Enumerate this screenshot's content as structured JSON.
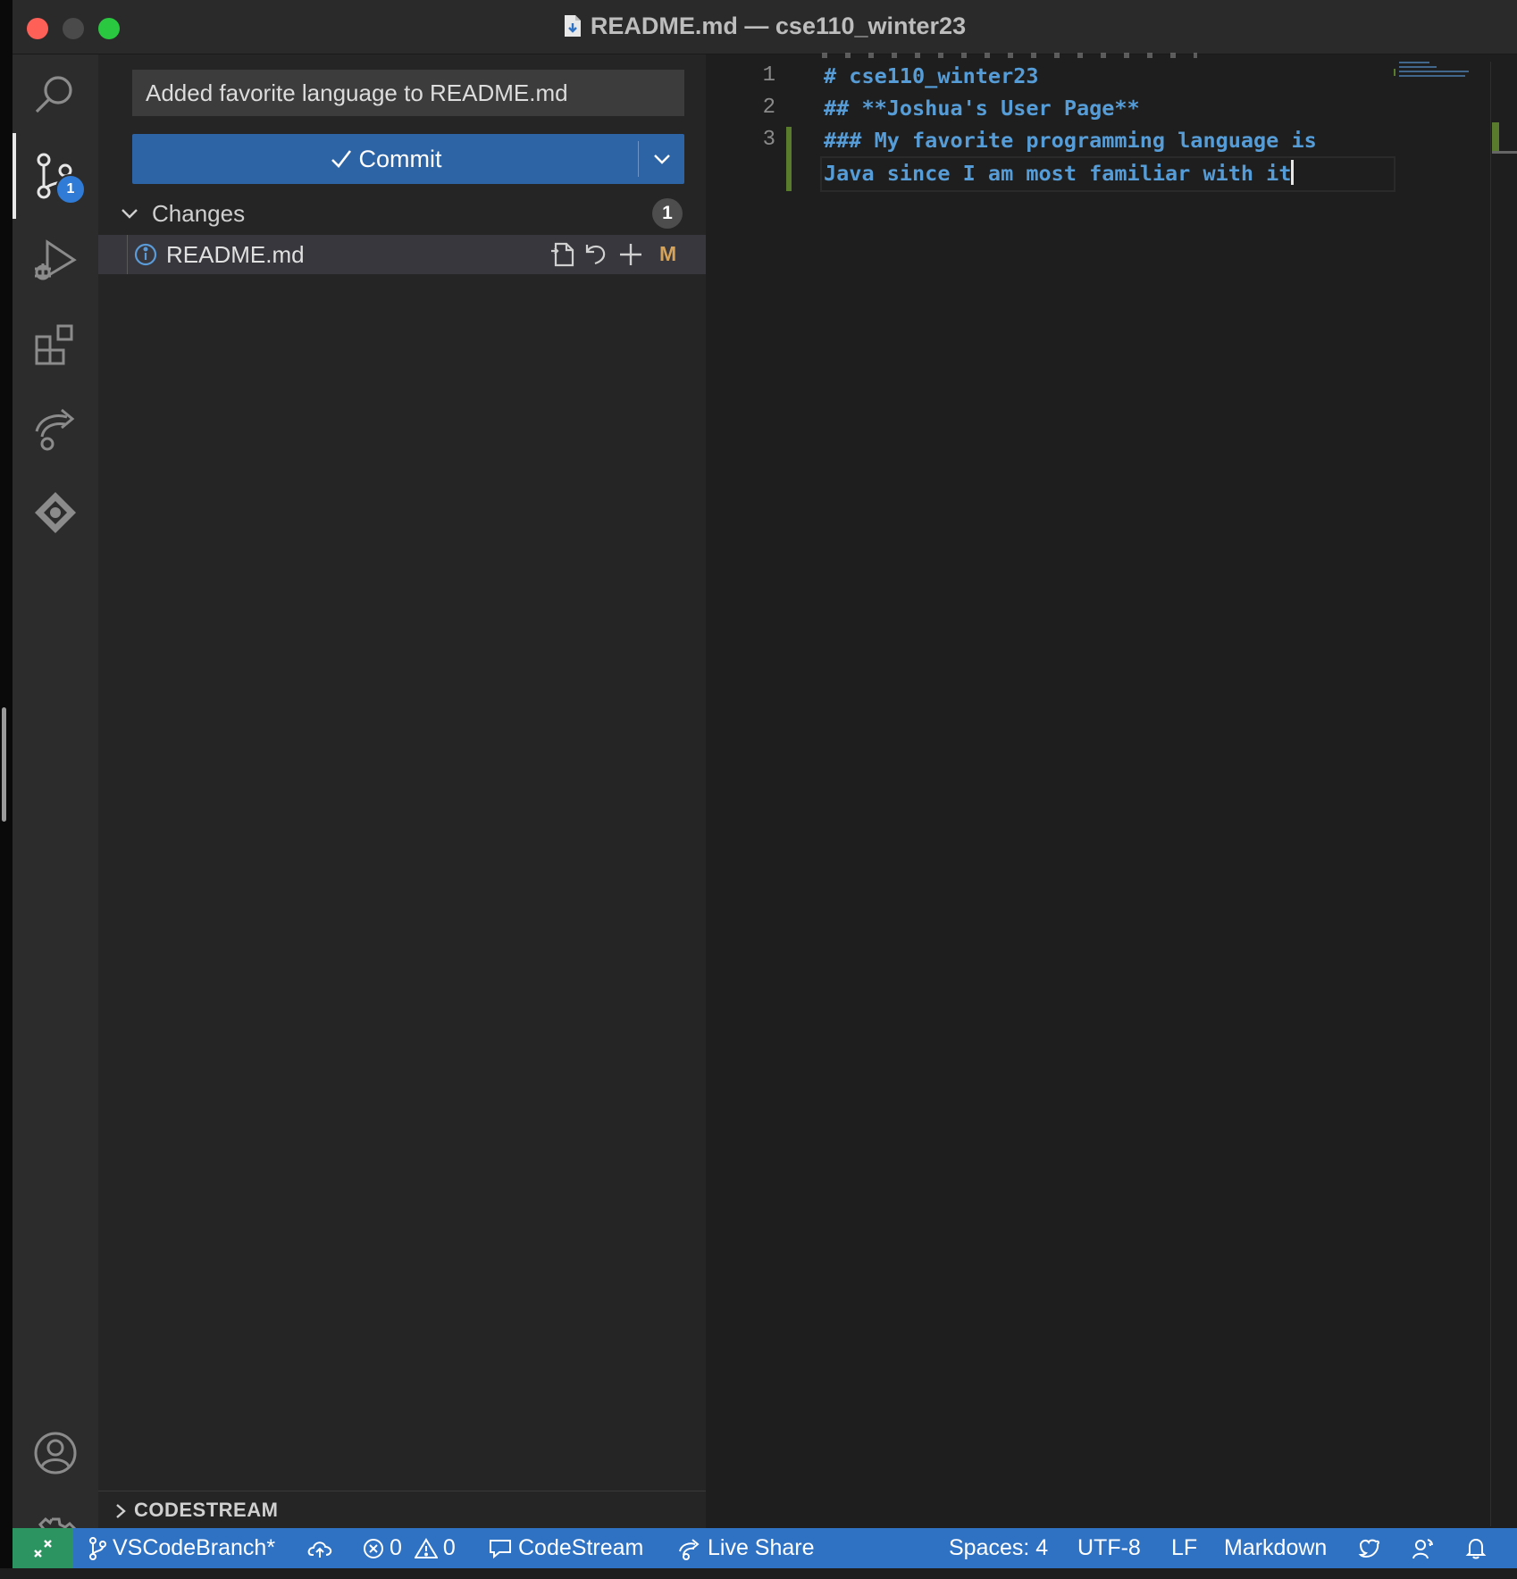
{
  "window": {
    "title": "README.md — cse110_winter23"
  },
  "activity_bar": {
    "items": [
      "search",
      "source-control",
      "run-and-debug",
      "extensions",
      "live-share",
      "codestream"
    ],
    "source_control_badge": "1",
    "bottom_items": [
      "accounts",
      "manage"
    ]
  },
  "source_control": {
    "commit_message": "Added favorite language to README.md",
    "commit_button_label": "Commit",
    "changes_label": "Changes",
    "changes_count": "1",
    "files": [
      {
        "name": "README.md",
        "status": "M"
      }
    ],
    "codestream_section_label": "CODESTREAM"
  },
  "editor": {
    "line_numbers": [
      "1",
      "2",
      "3"
    ],
    "lines": [
      "# cse110_winter23",
      "## **Joshua's User Page**",
      "### My favorite programming language is",
      "Java since I am most familiar with it"
    ],
    "syntax_color": "#569cd6",
    "diff_added_color": "#587c2c"
  },
  "status_bar": {
    "branch": "VSCodeBranch*",
    "errors": "0",
    "warnings": "0",
    "codestream": "CodeStream",
    "live_share": "Live Share",
    "spaces": "Spaces: 4",
    "encoding": "UTF-8",
    "eol": "LF",
    "language": "Markdown",
    "background_color": "#2f72c4",
    "remote_color": "#2c9460"
  }
}
